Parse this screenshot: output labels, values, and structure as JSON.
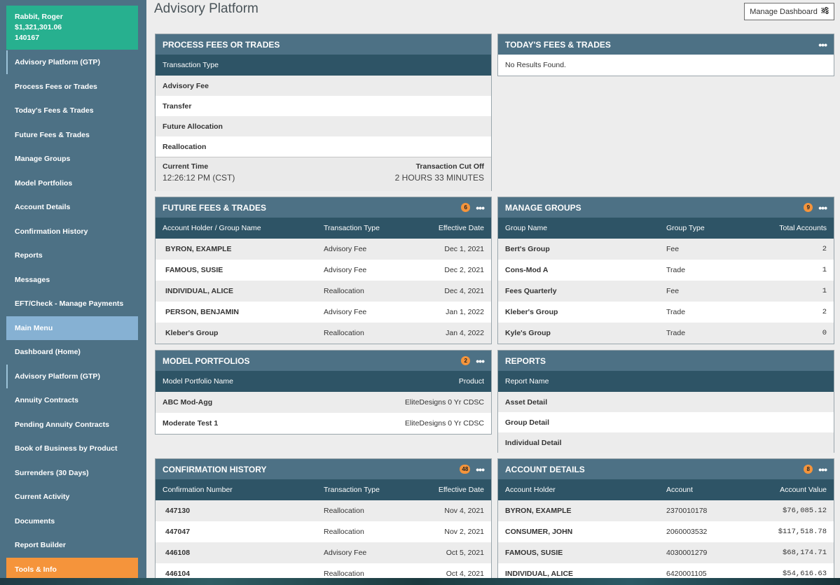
{
  "user": {
    "name": "Rabbit, Roger",
    "balance": "$1,321,301.06",
    "id": "140167"
  },
  "sidebar": {
    "items": [
      {
        "label": "Advisory Platform (GTP)"
      },
      {
        "label": "Process Fees or Trades"
      },
      {
        "label": "Today's Fees & Trades"
      },
      {
        "label": "Future Fees & Trades"
      },
      {
        "label": "Manage Groups"
      },
      {
        "label": "Model Portfolios"
      },
      {
        "label": "Account Details"
      },
      {
        "label": "Confirmation History"
      },
      {
        "label": "Reports"
      },
      {
        "label": "Messages"
      },
      {
        "label": "EFT/Check - Manage Payments"
      }
    ],
    "main_menu": "Main Menu",
    "main_items": [
      {
        "label": "Dashboard (Home)"
      },
      {
        "label": "Advisory Platform (GTP)"
      },
      {
        "label": "Annuity Contracts"
      },
      {
        "label": "Pending Annuity Contracts"
      },
      {
        "label": "Book of Business by Product"
      },
      {
        "label": "Surrenders (30 Days)"
      },
      {
        "label": "Current Activity"
      },
      {
        "label": "Documents"
      },
      {
        "label": "Report Builder"
      }
    ],
    "tools": "Tools & Info"
  },
  "header": {
    "title": "Advisory Platform",
    "manage_btn": "Manage Dashboard"
  },
  "process": {
    "title": "PROCESS FEES OR TRADES",
    "col": "Transaction Type",
    "rows": [
      "Advisory Fee",
      "Transfer",
      "Future Allocation",
      "Reallocation"
    ],
    "current_time_label": "Current Time",
    "current_time": "12:26:12 PM (CST)",
    "cutoff_label": "Transaction Cut Off",
    "cutoff": "2 HOURS 33 MINUTES"
  },
  "today": {
    "title": "TODAY'S FEES & TRADES",
    "empty": "No Results Found."
  },
  "future": {
    "title": "FUTURE FEES & TRADES",
    "badge": "6",
    "cols": [
      "Account Holder / Group Name",
      "Transaction Type",
      "Effective Date"
    ],
    "rows": [
      [
        "BYRON, EXAMPLE",
        "Advisory Fee",
        "Dec 1, 2021"
      ],
      [
        "FAMOUS, SUSIE",
        "Advisory Fee",
        "Dec 2, 2021"
      ],
      [
        "INDIVIDUAL, ALICE",
        "Reallocation",
        "Dec 4, 2021"
      ],
      [
        "PERSON, BENJAMIN",
        "Advisory Fee",
        "Jan 1, 2022"
      ],
      [
        "Kleber's Group",
        "Reallocation",
        "Jan 4, 2022"
      ]
    ]
  },
  "groups": {
    "title": "MANAGE GROUPS",
    "badge": "9",
    "cols": [
      "Group Name",
      "Group Type",
      "Total Accounts"
    ],
    "rows": [
      [
        "Bert's Group",
        "Fee",
        "2"
      ],
      [
        "Cons-Mod A",
        "Trade",
        "1"
      ],
      [
        "Fees Quarterly",
        "Fee",
        "1"
      ],
      [
        "Kleber's Group",
        "Trade",
        "2"
      ],
      [
        "Kyle's Group",
        "Trade",
        "0"
      ]
    ]
  },
  "models": {
    "title": "MODEL PORTFOLIOS",
    "badge": "2",
    "cols": [
      "Model Portfolio Name",
      "Product"
    ],
    "rows": [
      [
        "ABC Mod-Agg",
        "EliteDesigns 0 Yr CDSC"
      ],
      [
        "Moderate Test 1",
        "EliteDesigns 0 Yr CDSC"
      ]
    ]
  },
  "reports": {
    "title": "REPORTS",
    "col": "Report Name",
    "rows": [
      "Asset Detail",
      "Group Detail",
      "Individual Detail"
    ]
  },
  "confirm": {
    "title": "CONFIRMATION HISTORY",
    "badge": "48",
    "cols": [
      "Confirmation Number",
      "Transaction Type",
      "Effective Date"
    ],
    "rows": [
      [
        "447130",
        "Reallocation",
        "Nov 4, 2021"
      ],
      [
        "447047",
        "Reallocation",
        "Nov 2, 2021"
      ],
      [
        "446108",
        "Advisory Fee",
        "Oct 5, 2021"
      ],
      [
        "446104",
        "Reallocation",
        "Oct 4, 2021"
      ]
    ]
  },
  "accounts": {
    "title": "ACCOUNT DETAILS",
    "badge": "8",
    "cols": [
      "Account Holder",
      "Account",
      "Account Value"
    ],
    "rows": [
      [
        "BYRON, EXAMPLE",
        "2370010178",
        "$76,085.12"
      ],
      [
        "CONSUMER, JOHN",
        "2060003532",
        "$117,518.78"
      ],
      [
        "FAMOUS, SUSIE",
        "4030001279",
        "$68,174.71"
      ],
      [
        "INDIVIDUAL, ALICE",
        "6420001105",
        "$54,616.63"
      ]
    ]
  },
  "colors": {
    "sidebar": "#4d7185",
    "user_card": "#27b08f",
    "section": "#86b1d3",
    "tools": "#f5943b",
    "panel_head": "#4d7185",
    "col_head": "#2e5466",
    "badge": "#f5943b"
  },
  "icons": {
    "more": "ellipsis-icon",
    "settings": "sliders-icon"
  }
}
